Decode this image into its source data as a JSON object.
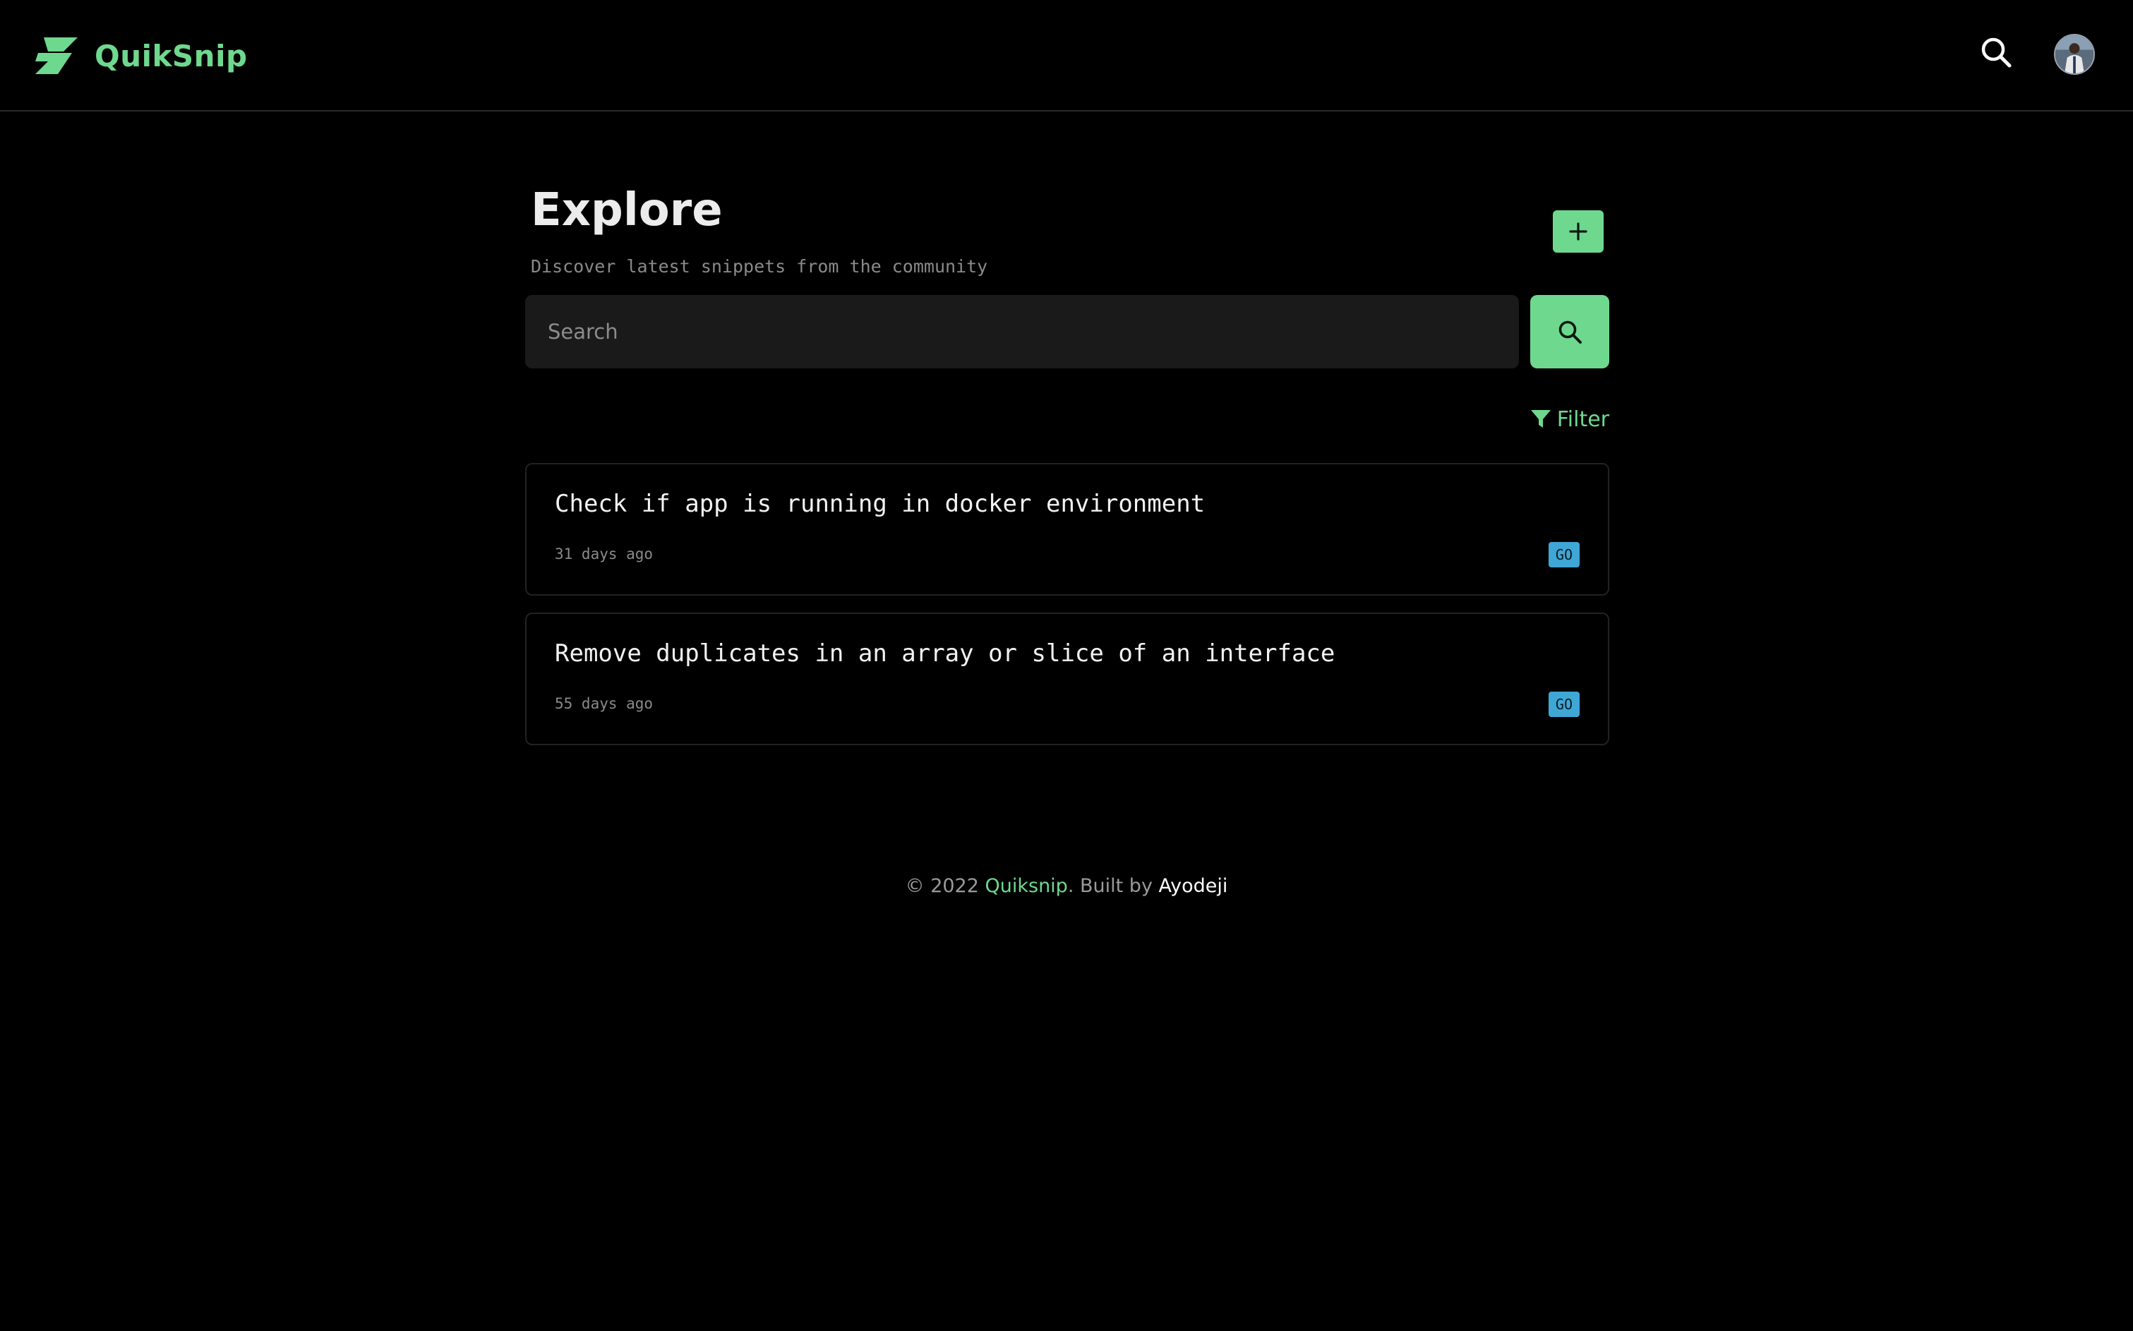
{
  "colors": {
    "accent": "#6fd88f",
    "background": "#000000",
    "badge_go": "#3fa7d6"
  },
  "header": {
    "brand_name": "QuikSnip",
    "logo_icon": "lightning-bolt-icon",
    "search_icon": "search-icon",
    "avatar_icon": "user-avatar"
  },
  "main": {
    "title": "Explore",
    "subtitle": "Discover latest snippets from the community",
    "add_icon": "plus-icon",
    "search": {
      "placeholder": "Search",
      "value": "",
      "button_icon": "search-icon"
    },
    "filter": {
      "label": "Filter",
      "icon": "funnel-icon"
    },
    "snippets": [
      {
        "title": "Check if app is running in docker environment",
        "time": "31 days ago",
        "language": "GO"
      },
      {
        "title": "Remove duplicates in an array or slice of an interface",
        "time": "55 days ago",
        "language": "GO"
      }
    ]
  },
  "footer": {
    "copyright": "© 2022 ",
    "brand": "Quiksnip",
    "built_by": ". Built by ",
    "author": "Ayodeji"
  }
}
